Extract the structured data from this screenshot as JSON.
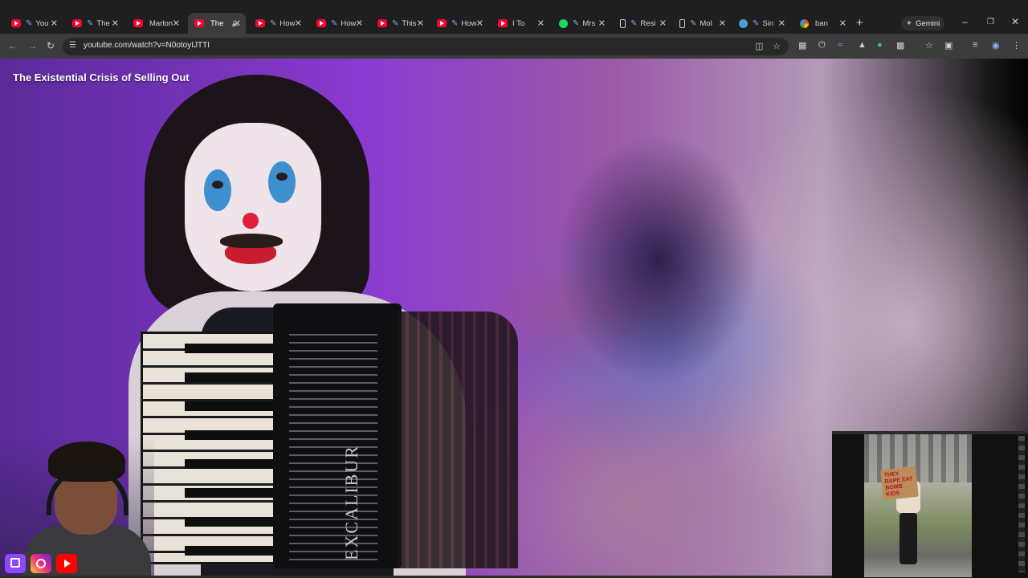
{
  "tabs": [
    {
      "icon": "youtube-icon",
      "label": "You"
    },
    {
      "icon": "youtube-icon",
      "label": "The"
    },
    {
      "icon": "youtube-icon",
      "label": "Marlon"
    },
    {
      "icon": "youtube-icon",
      "label": "The"
    },
    {
      "icon": "youtube-icon",
      "label": "How"
    },
    {
      "icon": "youtube-icon",
      "label": "How"
    },
    {
      "icon": "youtube-icon",
      "label": "This"
    },
    {
      "icon": "youtube-icon",
      "label": "How"
    },
    {
      "icon": "youtube-icon",
      "label": "I To"
    },
    {
      "icon": "spotify-icon",
      "label": "Mrs"
    },
    {
      "icon": "document-icon",
      "label": "Resi"
    },
    {
      "icon": "document-icon",
      "label": "Mol"
    },
    {
      "icon": "globe-icon",
      "label": "Sin"
    },
    {
      "icon": "google-icon",
      "label": "ban"
    }
  ],
  "gemini_label": "Gemini",
  "address": {
    "url": "youtube.com/watch?v=N0otoyIJTTI"
  },
  "video": {
    "title": "The Existential Crisis of Selling Out",
    "accordion_brand": "EXCALIBUR",
    "pip_sign": "THEY RAPE EAT BOMB KIDS"
  },
  "colors": {
    "tab_bg": "#1f1f1f",
    "active_tab": "#3c3c3c",
    "youtube_red": "#ff0033",
    "link_blue": "#8ab4f8"
  }
}
